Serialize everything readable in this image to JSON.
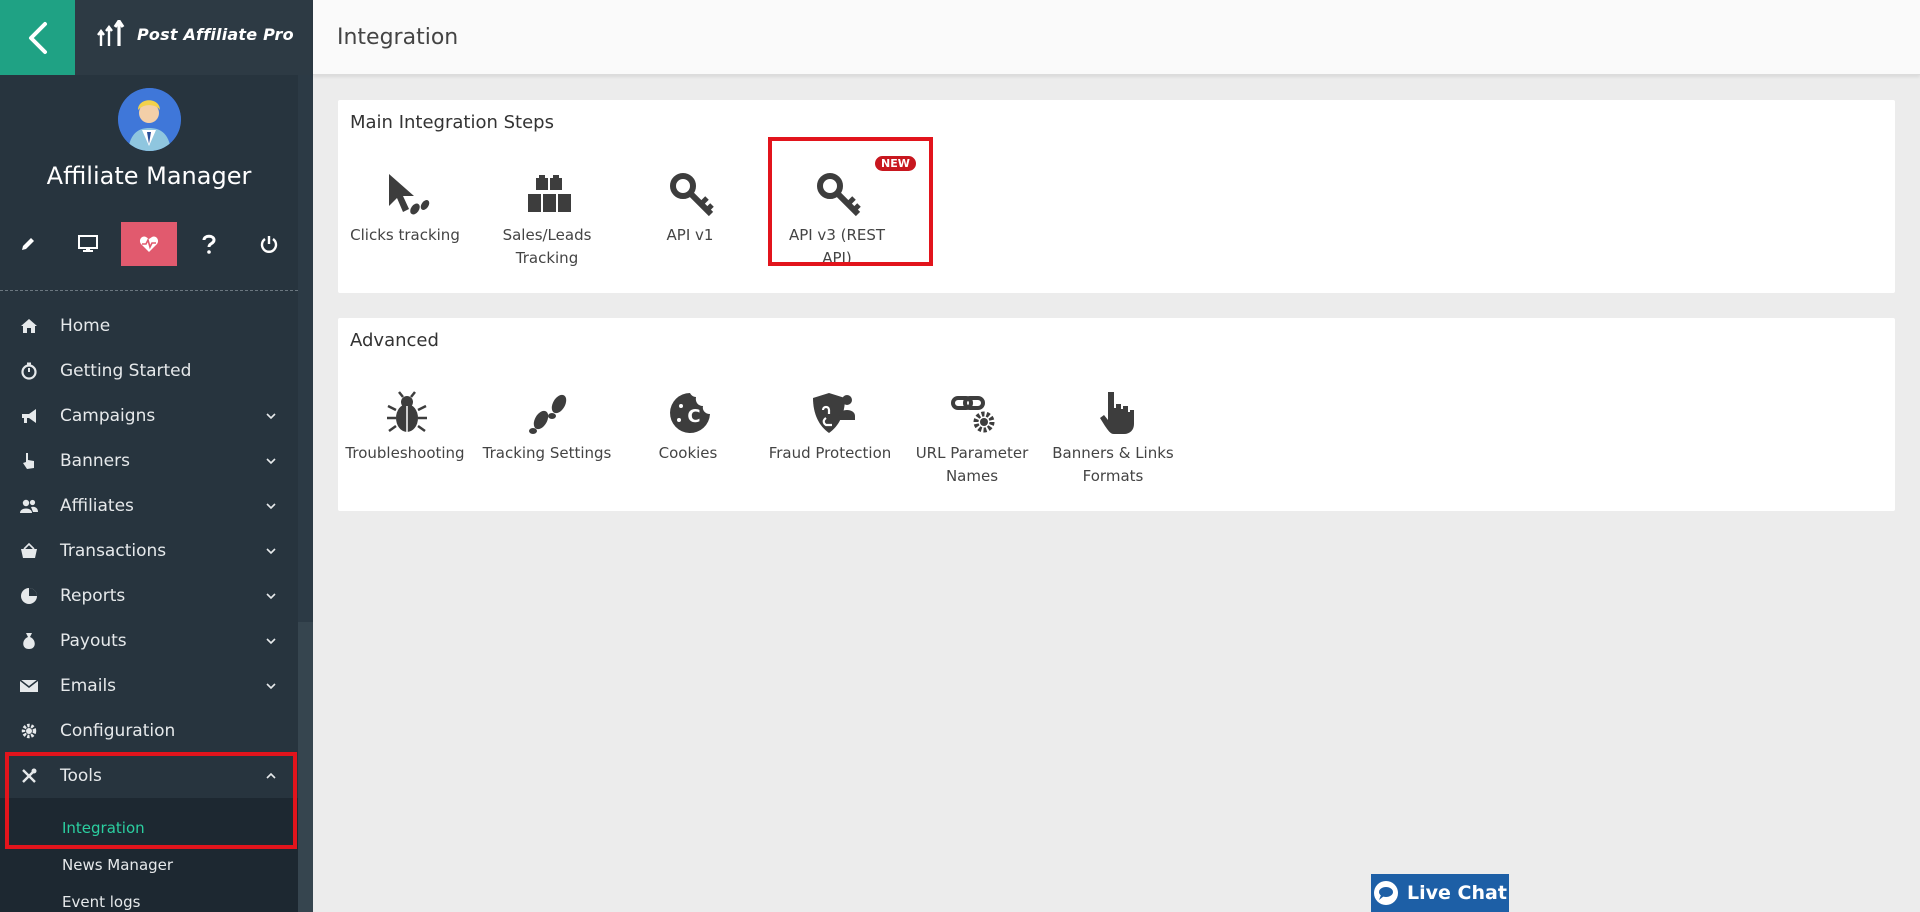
{
  "app": {
    "logo_text": "Post Affiliate Pro",
    "role_title": "Affiliate Manager"
  },
  "header": {
    "title": "Integration"
  },
  "quick_actions": [
    {
      "icon": "pencil-icon"
    },
    {
      "icon": "monitor-icon"
    },
    {
      "icon": "heart-pulse-icon",
      "active": true
    },
    {
      "icon": "question-icon"
    },
    {
      "icon": "power-icon"
    }
  ],
  "nav": {
    "items": [
      {
        "label": "Home",
        "icon": "home-icon"
      },
      {
        "label": "Getting Started",
        "icon": "stopwatch-icon"
      },
      {
        "label": "Campaigns",
        "icon": "megaphone-icon"
      },
      {
        "label": "Banners",
        "icon": "hand-pointer-icon"
      },
      {
        "label": "Affiliates",
        "icon": "users-icon"
      },
      {
        "label": "Transactions",
        "icon": "basket-icon"
      },
      {
        "label": "Reports",
        "icon": "pie-chart-icon"
      },
      {
        "label": "Payouts",
        "icon": "money-bag-icon"
      },
      {
        "label": "Emails",
        "icon": "envelope-icon"
      },
      {
        "label": "Configuration",
        "icon": "gear-icon"
      },
      {
        "label": "Tools",
        "icon": "tools-icon"
      }
    ],
    "tools_sub": [
      {
        "label": "Integration",
        "active": true
      },
      {
        "label": "News Manager"
      },
      {
        "label": "Event logs"
      }
    ]
  },
  "main_steps": {
    "title": "Main Integration Steps",
    "tiles": [
      {
        "label": "Clicks tracking",
        "icon": "cursor-click-icon"
      },
      {
        "label": "Sales/Leads Tracking",
        "icon": "bricks-icon"
      },
      {
        "label": "API v1",
        "icon": "key-icon"
      },
      {
        "label": "API v3 (REST API)",
        "icon": "key-icon",
        "badge": "NEW"
      }
    ]
  },
  "advanced": {
    "title": "Advanced",
    "tiles": [
      {
        "label": "Troubleshooting",
        "icon": "bug-icon"
      },
      {
        "label": "Tracking Settings",
        "icon": "footprints-icon"
      },
      {
        "label": "Cookies",
        "icon": "cookie-icon"
      },
      {
        "label": "Fraud Protection",
        "icon": "shield-icon"
      },
      {
        "label": "URL Parameter Names",
        "icon": "link-gear-icon"
      },
      {
        "label": "Banners & Links Formats",
        "icon": "hand-pointer-icon"
      }
    ]
  },
  "live_chat": {
    "label": "Live Chat"
  },
  "colors": {
    "sidebar_bg": "#27343e",
    "accent_green": "#1fa284",
    "active_pink": "#e15a6e",
    "highlight_red": "#e2141c",
    "live_chat_blue": "#1d5fa6"
  }
}
